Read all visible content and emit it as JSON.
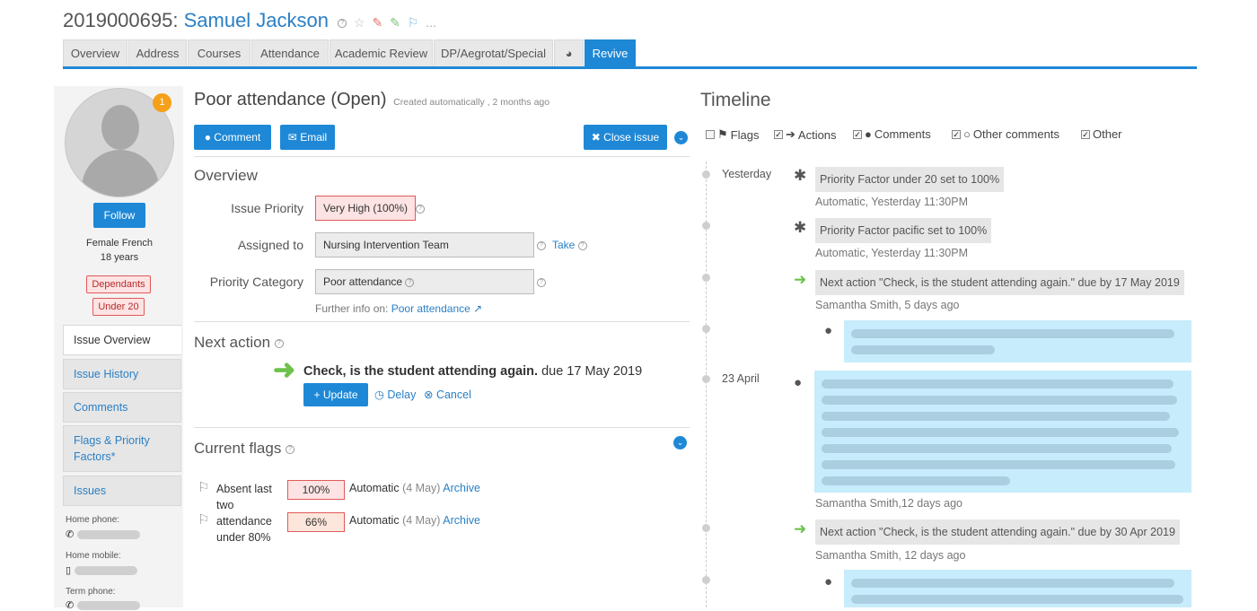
{
  "header": {
    "student_id": "2019000695:",
    "student_name": "Samuel Jackson",
    "help_icon": "help-icon",
    "more": "..."
  },
  "tabs": [
    {
      "label": "Overview"
    },
    {
      "label": "Address"
    },
    {
      "label": "Courses"
    },
    {
      "label": "Attendance"
    },
    {
      "label": "Academic Review"
    },
    {
      "label": "DP/Aegrotat/Special"
    },
    {
      "label": "",
      "icon": "pie-chart-icon"
    },
    {
      "label": "Revive",
      "active": true
    }
  ],
  "profile": {
    "notification_count": "1",
    "follow_label": "Follow",
    "gender_ethnicity": "Female French",
    "age": "18 years",
    "tags": [
      "Dependants",
      "Under 20"
    ]
  },
  "side_nav": [
    {
      "label": "Issue Overview",
      "active": true
    },
    {
      "label": "Issue History"
    },
    {
      "label": "Comments"
    },
    {
      "label": "Flags & Priority Factors*"
    },
    {
      "label": "Issues"
    }
  ],
  "contacts": [
    {
      "label": "Home phone:",
      "icon": "phone-icon"
    },
    {
      "label": "Home mobile:",
      "icon": "mobile-icon"
    },
    {
      "label": "Term phone:",
      "icon": "phone-icon"
    }
  ],
  "issue": {
    "title": "Poor attendance (Open)",
    "meta": "Created automatically , 2 months ago",
    "comment_label": "Comment",
    "email_label": "Email",
    "close_label": "Close issue",
    "overview_title": "Overview",
    "priority_label": "Issue Priority",
    "priority_value": "Very High (100%)",
    "assigned_label": "Assigned to",
    "assigned_value": "Nursing Intervention Team",
    "take_label": "Take",
    "category_label": "Priority Category",
    "category_value": "Poor attendance",
    "further_info_label": "Further info on:",
    "further_info_link": "Poor attendance"
  },
  "next_action": {
    "title": "Next action",
    "text": "Check, is the student attending again.",
    "due": "due 17 May 2019",
    "update_label": "Update",
    "delay_label": "Delay",
    "cancel_label": "Cancel"
  },
  "flags": {
    "title": "Current flags",
    "items": [
      {
        "name": "Absent last two",
        "pct": "100%",
        "source": "Automatic",
        "date": "(4 May)",
        "action": "Archive"
      },
      {
        "name": "attendance under 80%",
        "pct": "66%",
        "source": "Automatic",
        "date": "(4 May)",
        "action": "Archive"
      }
    ]
  },
  "timeline": {
    "title": "Timeline",
    "filters": [
      {
        "label": "Flags",
        "checked": false,
        "icon": "flag-icon"
      },
      {
        "label": "Actions",
        "checked": true,
        "icon": "arrow-right-icon"
      },
      {
        "label": "Comments",
        "checked": true,
        "icon": "comment-icon"
      },
      {
        "label": "Other comments",
        "checked": true,
        "icon": "comment-outline-icon"
      },
      {
        "label": "Other",
        "checked": true
      }
    ],
    "dates": [
      "Yesterday",
      "23 April"
    ],
    "events": [
      {
        "text": "Priority Factor under 20 set to 100%",
        "by": "Automatic, Yesterday 11:30PM"
      },
      {
        "text": "Priority Factor pacific set to 100%",
        "by": "Automatic, Yesterday 11:30PM"
      },
      {
        "text": "Next action \"Check, is the student attending again.\" due by 17 May 2019",
        "by": "Samantha Smith, 5 days ago"
      },
      {
        "by": "Samantha Smith,12 days ago"
      },
      {
        "text": "Next action \"Check, is the student attending again.\" due by 30 Apr 2019",
        "by": "Samantha Smith, 12 days ago"
      }
    ],
    "open_quote": "“",
    "close_quote": "”"
  }
}
